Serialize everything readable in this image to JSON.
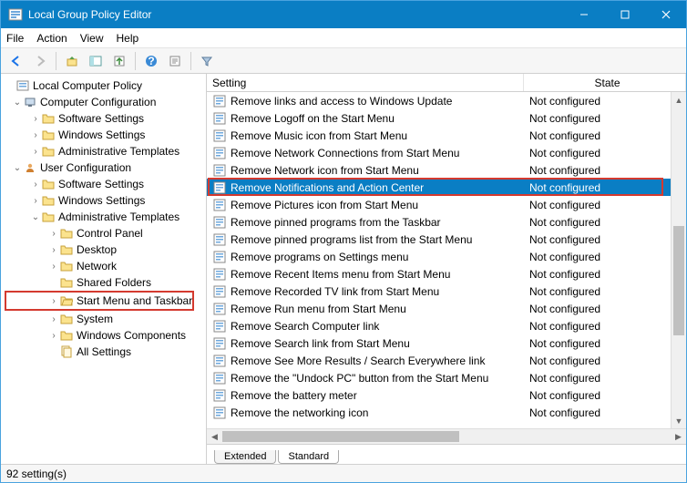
{
  "window": {
    "title": "Local Group Policy Editor"
  },
  "menu": {
    "file": "File",
    "action": "Action",
    "view": "View",
    "help": "Help"
  },
  "tree": {
    "root": "Local Computer Policy",
    "comp_config": "Computer Configuration",
    "user_config": "User Configuration",
    "software": "Software Settings",
    "windows": "Windows Settings",
    "admin": "Administrative Templates",
    "control_panel": "Control Panel",
    "desktop": "Desktop",
    "network": "Network",
    "shared_folders": "Shared Folders",
    "start_menu": "Start Menu and Taskbar",
    "system": "System",
    "win_components": "Windows Components",
    "all_settings": "All Settings"
  },
  "columns": {
    "setting": "Setting",
    "state": "State"
  },
  "state_nc": "Not configured",
  "settings": [
    "Remove links and access to Windows Update",
    "Remove Logoff on the Start Menu",
    "Remove Music icon from Start Menu",
    "Remove Network Connections from Start Menu",
    "Remove Network icon from Start Menu",
    "Remove Notifications and Action Center",
    "Remove Pictures icon from Start Menu",
    "Remove pinned programs from the Taskbar",
    "Remove pinned programs list from the Start Menu",
    "Remove programs on Settings menu",
    "Remove Recent Items menu from Start Menu",
    "Remove Recorded TV link from Start Menu",
    "Remove Run menu from Start Menu",
    "Remove Search Computer link",
    "Remove Search link from Start Menu",
    "Remove See More Results / Search Everywhere link",
    "Remove the \"Undock PC\" button from the Start Menu",
    "Remove the battery meter",
    "Remove the networking icon"
  ],
  "tabs": {
    "extended": "Extended",
    "standard": "Standard"
  },
  "status": "92 setting(s)"
}
